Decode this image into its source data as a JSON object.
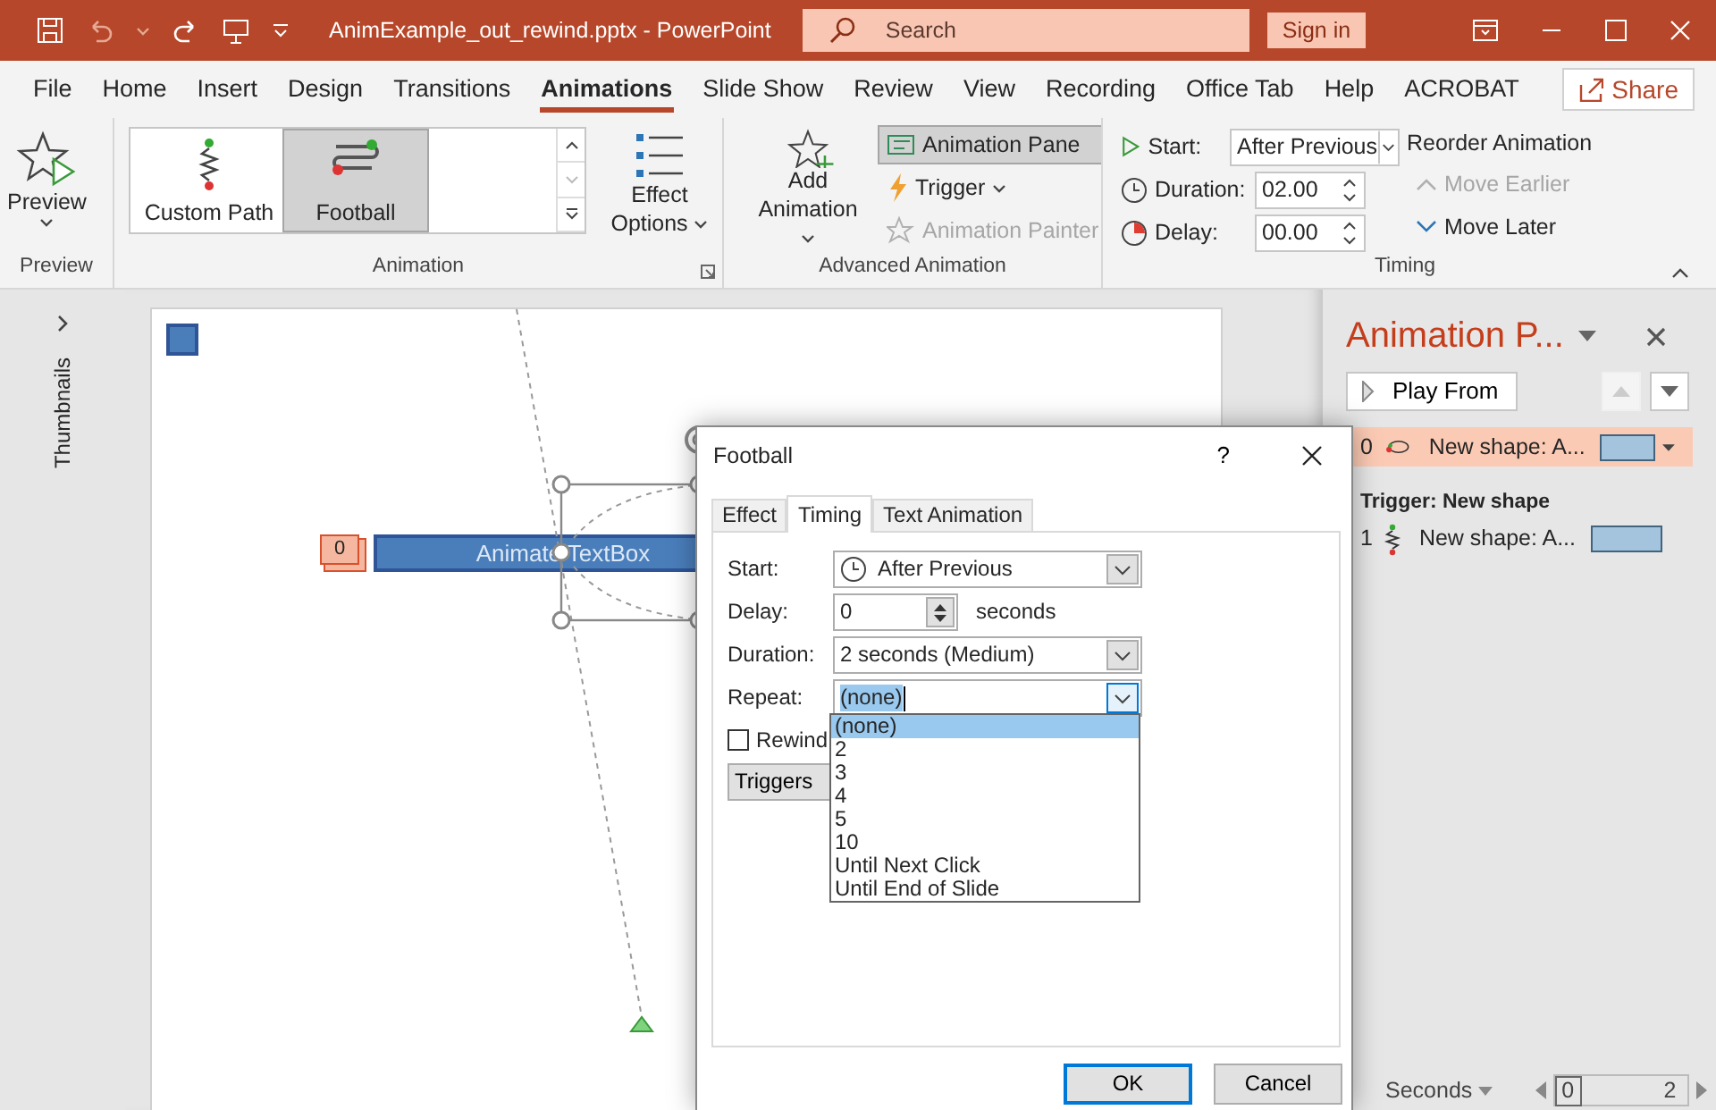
{
  "title_bar": {
    "document_title": "AnimExample_out_rewind.pptx  -  PowerPoint",
    "search": {
      "placeholder": "Search"
    },
    "sign_in": "Sign in"
  },
  "menu_tabs": [
    {
      "label": "File",
      "selected": false
    },
    {
      "label": "Home",
      "selected": false
    },
    {
      "label": "Insert",
      "selected": false
    },
    {
      "label": "Design",
      "selected": false
    },
    {
      "label": "Transitions",
      "selected": false
    },
    {
      "label": "Animations",
      "selected": true
    },
    {
      "label": "Slide Show",
      "selected": false
    },
    {
      "label": "Review",
      "selected": false
    },
    {
      "label": "View",
      "selected": false
    },
    {
      "label": "Recording",
      "selected": false
    },
    {
      "label": "Office Tab",
      "selected": false
    },
    {
      "label": "Help",
      "selected": false
    },
    {
      "label": "ACROBAT",
      "selected": false
    }
  ],
  "share": "Share",
  "ribbon": {
    "preview": {
      "button": "Preview",
      "group_label": "Preview"
    },
    "animation": {
      "gallery": [
        {
          "label": "Custom Path",
          "kind": "custom-path",
          "selected": false
        },
        {
          "label": "Football",
          "kind": "football",
          "selected": true
        }
      ],
      "effect_options": "Effect Options",
      "group_label": "Animation"
    },
    "advanced_animation": {
      "add_animation": "Add Animation",
      "animation_pane": {
        "label": "Animation Pane",
        "selected": true
      },
      "trigger": "Trigger",
      "animation_painter": {
        "label": "Animation Painter",
        "disabled": true
      },
      "group_label": "Advanced Animation"
    },
    "timing": {
      "start": {
        "label": "Start:",
        "value": "After Previous"
      },
      "duration": {
        "label": "Duration:",
        "value": "02.00"
      },
      "delay": {
        "label": "Delay:",
        "value": "00.00"
      },
      "reorder_title": "Reorder Animation",
      "move_earlier": {
        "label": "Move Earlier",
        "disabled": true
      },
      "move_later": {
        "label": "Move Later",
        "disabled": false
      },
      "group_label": "Timing"
    }
  },
  "thumbnails_pane": {
    "label": "Thumbnails"
  },
  "slide": {
    "order_badge": "0",
    "text_box": "Animate TextBox"
  },
  "dialog": {
    "title": "Football",
    "help": "?",
    "tabs": [
      {
        "label": "Effect",
        "selected": false
      },
      {
        "label": "Timing",
        "selected": true
      },
      {
        "label": "Text Animation",
        "selected": false
      }
    ],
    "start": {
      "label": "Start:",
      "value": "After Previous"
    },
    "delay": {
      "label": "Delay:",
      "value": "0",
      "unit": "seconds"
    },
    "duration": {
      "label": "Duration:",
      "value": "2 seconds (Medium)"
    },
    "repeat": {
      "label": "Repeat:",
      "value": "(none)",
      "expanded": true,
      "options": [
        {
          "label": "(none)",
          "selected": true
        },
        {
          "label": "2",
          "selected": false
        },
        {
          "label": "3",
          "selected": false
        },
        {
          "label": "4",
          "selected": false
        },
        {
          "label": "5",
          "selected": false
        },
        {
          "label": "10",
          "selected": false
        },
        {
          "label": "Until Next Click",
          "selected": false
        },
        {
          "label": "Until End of Slide",
          "selected": false
        }
      ]
    },
    "rewind": {
      "label": "Rewind",
      "checked": false
    },
    "triggers": "Triggers",
    "buttons": [
      {
        "label": "OK",
        "default": true
      },
      {
        "label": "Cancel",
        "default": false
      }
    ]
  },
  "animation_pane": {
    "title": "Animation P...",
    "play_from": "Play From",
    "move_up": {
      "disabled": true
    },
    "move_down": {
      "disabled": false
    },
    "items": [
      {
        "number": "0",
        "kind": "football",
        "label": "New shape: A...",
        "selected": true
      }
    ],
    "trigger_groups": [
      {
        "heading": "Trigger: New shape",
        "items": [
          {
            "number": "1",
            "kind": "custom-path",
            "label": "New shape: A...",
            "selected": false
          }
        ]
      }
    ],
    "footer": {
      "units": "Seconds",
      "timeline_start": "0",
      "timeline_end": "2"
    }
  }
}
